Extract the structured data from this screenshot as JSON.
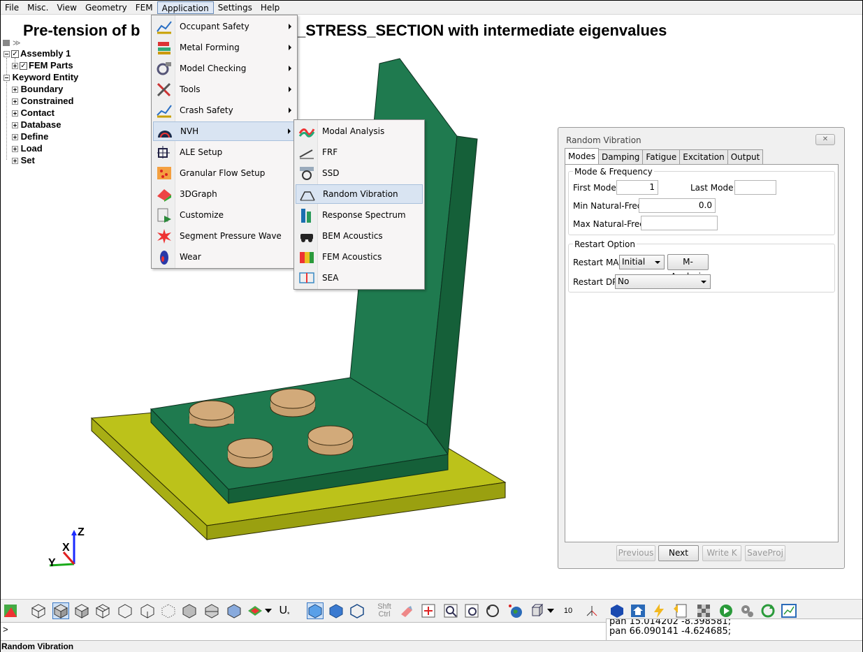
{
  "menubar": [
    "File",
    "Misc.",
    "View",
    "Geometry",
    "FEM",
    "Application",
    "Settings",
    "Help"
  ],
  "title": "Pre-tension of b",
  "title_right": "_STRESS_SECTION with intermediate eigenvalues",
  "tree": {
    "assembly": "Assembly 1",
    "fem_parts": "FEM Parts",
    "keyword_entity": "Keyword Entity",
    "children": [
      "Boundary",
      "Constrained",
      "Contact",
      "Database",
      "Define",
      "Load",
      "Set"
    ]
  },
  "app_menu": [
    {
      "label": "Occupant Safety",
      "icon": "occupant-safety-icon",
      "sub": true
    },
    {
      "label": "Metal Forming",
      "icon": "metal-forming-icon",
      "sub": true
    },
    {
      "label": "Model Checking",
      "icon": "model-checking-icon",
      "sub": true
    },
    {
      "label": "Tools",
      "icon": "tools-icon",
      "sub": true
    },
    {
      "label": "Crash Safety",
      "icon": "crash-safety-icon",
      "sub": true
    },
    {
      "label": "NVH",
      "icon": "nvh-icon",
      "sub": true
    },
    {
      "label": "ALE Setup",
      "icon": "ale-setup-icon",
      "sub": false
    },
    {
      "label": "Granular Flow Setup",
      "icon": "granular-flow-icon",
      "sub": false
    },
    {
      "label": "3DGraph",
      "icon": "3dgraph-icon",
      "sub": false
    },
    {
      "label": "Customize",
      "icon": "customize-icon",
      "sub": false
    },
    {
      "label": "Segment Pressure Wave",
      "icon": "pressure-wave-icon",
      "sub": false
    },
    {
      "label": "Wear",
      "icon": "wear-icon",
      "sub": false
    }
  ],
  "nvh_menu": [
    {
      "label": "Modal Analysis",
      "icon": "modal-analysis-icon"
    },
    {
      "label": "FRF",
      "icon": "frf-icon"
    },
    {
      "label": "SSD",
      "icon": "ssd-icon"
    },
    {
      "label": "Random Vibration",
      "icon": "random-vibration-icon"
    },
    {
      "label": "Response Spectrum",
      "icon": "response-spectrum-icon"
    },
    {
      "label": "BEM Acoustics",
      "icon": "bem-acoustics-icon"
    },
    {
      "label": "FEM Acoustics",
      "icon": "fem-acoustics-icon"
    },
    {
      "label": "SEA",
      "icon": "sea-icon"
    }
  ],
  "dialog": {
    "title": "Random Vibration",
    "close": "✕",
    "tabs": [
      "Modes",
      "Damping",
      "Fatigue",
      "Excitation",
      "Output"
    ],
    "mode_group": "Mode & Frequency",
    "first_mode_label": "First Mode:",
    "first_mode_value": "1",
    "last_mode_label": "Last Mode:",
    "last_mode_value": "",
    "min_freq_label": "Min Natural-Freq:",
    "min_freq_value": "0.0",
    "max_freq_label": "Max Natural-Freq:",
    "max_freq_value": "",
    "restart_group": "Restart Option",
    "restart_ma_label": "Restart MA:",
    "restart_ma_value": "Initial",
    "m_analysis": "M-Analysis",
    "restart_dp_label": "Restart DP",
    "restart_dp_value": "No",
    "buttons": {
      "previous": "Previous",
      "next": "Next",
      "write": "Write K",
      "save": "SaveProj"
    }
  },
  "toolbar": {
    "shft": "Shft",
    "ctrl": "Ctrl",
    "u": "U",
    "ten": "10"
  },
  "cmd": {
    "prompt": ">"
  },
  "log": [
    "pan 15.014202 -8.398581;",
    "pan 66.090141 -4.624685;"
  ],
  "status": "Random Vibration",
  "axes": {
    "x": "X",
    "y": "Y",
    "z": "Z"
  },
  "colors": {
    "part_green": "#1f7a4f",
    "plate_yellow": "#bcc21a",
    "bolt": "#c8a070",
    "highlight": "#d9e4f2"
  }
}
